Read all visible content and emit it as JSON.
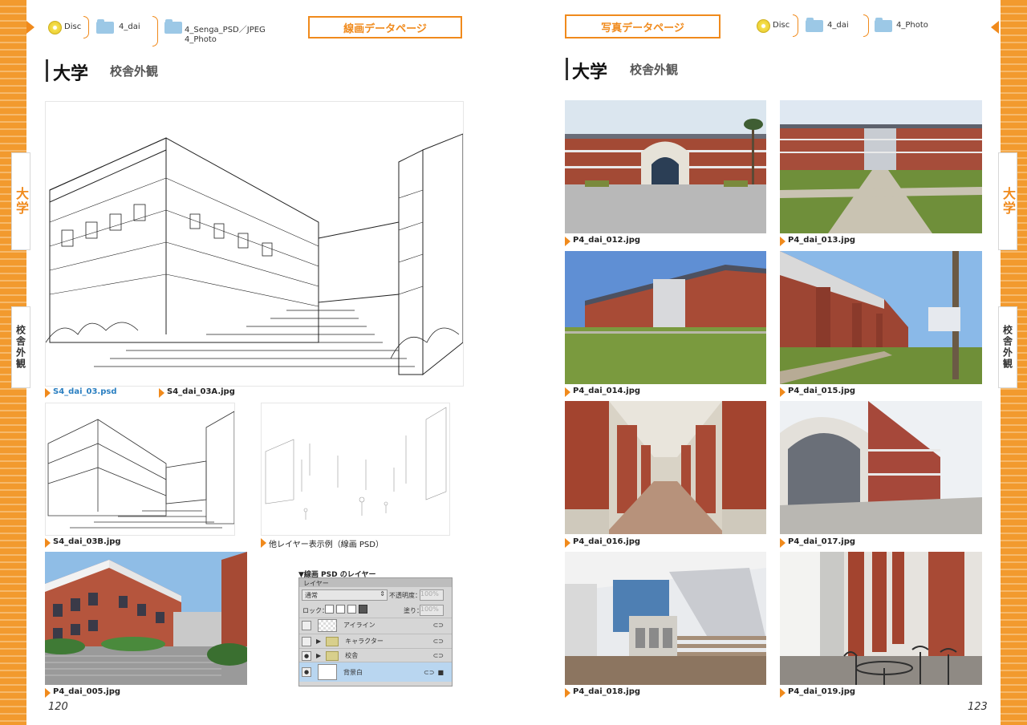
{
  "left_page": {
    "breadcrumb": [
      "Disc",
      "4_dai",
      "4_Senga_PSD／JPEG",
      "4_Photo"
    ],
    "page_button": "線画データページ",
    "heading_main": "大学",
    "heading_sub": "校舎外観",
    "captions": {
      "psd": "S4_dai_03.psd",
      "jpg_a": "S4_dai_03A.jpg",
      "jpg_b": "S4_dai_03B.jpg",
      "layer_example": "他レイヤー表示例（線画 PSD）",
      "photo_005": "P4_dai_005.jpg"
    },
    "layers_panel": {
      "title": "▼線画 PSD のレイヤー",
      "tab": "レイヤー",
      "blend_mode": "通常",
      "opacity_label": "不透明度：",
      "opacity_value": "100%",
      "lock_label": "ロック：",
      "fill_label": "塗り：",
      "fill_value": "100%",
      "layers": [
        "アイライン",
        "キャラクター",
        "校舎",
        "背景白"
      ]
    },
    "page_number": "120",
    "edge_tabs": [
      "大学",
      "校舎外観"
    ]
  },
  "right_page": {
    "page_button": "写真データページ",
    "breadcrumb": [
      "Disc",
      "4_dai",
      "4_Photo"
    ],
    "heading_main": "大学",
    "heading_sub": "校舎外観",
    "photos": [
      "P4_dai_012.jpg",
      "P4_dai_013.jpg",
      "P4_dai_014.jpg",
      "P4_dai_015.jpg",
      "P4_dai_016.jpg",
      "P4_dai_017.jpg",
      "P4_dai_018.jpg",
      "P4_dai_019.jpg"
    ],
    "page_number": "123",
    "edge_tabs": [
      "大学",
      "校舎外観"
    ]
  },
  "colors": {
    "accent": "#f08a1c",
    "stripe_light": "#f6b96b",
    "link_blue": "#2a7fc1"
  }
}
